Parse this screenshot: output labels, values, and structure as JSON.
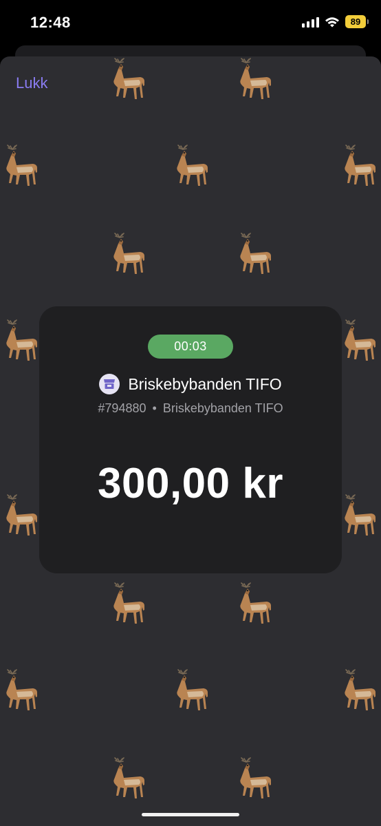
{
  "status_bar": {
    "time": "12:48",
    "battery": "89"
  },
  "sheet": {
    "close_label": "Lukk",
    "background_pattern_icon": "deer-icon"
  },
  "payment": {
    "timer": "00:03",
    "merchant_icon": "store-icon",
    "merchant_name": "Briskebybanden TIFO",
    "order_id": "#794880",
    "separator": "•",
    "merchant_sub": "Briskebybanden TIFO",
    "amount": "300,00 kr"
  },
  "colors": {
    "accent": "#8a7cf2",
    "timer_green": "#5aa862",
    "sheet_bg": "#2d2d31",
    "card_bg": "#1f1f21",
    "battery_yellow": "#f2cd3a"
  }
}
